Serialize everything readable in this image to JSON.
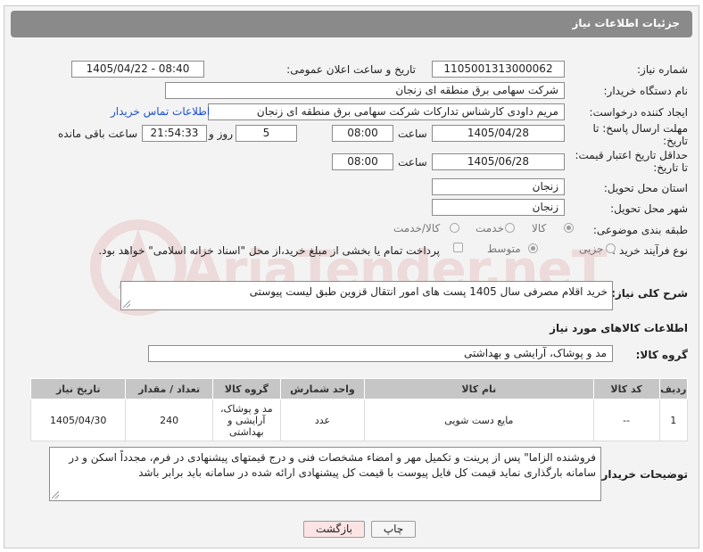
{
  "header": {
    "title": "جزئیات اطلاعات نیاز"
  },
  "watermark": {
    "text": "AriaTender.neT"
  },
  "need_number": {
    "label": "شماره نیاز:",
    "value": "1105001313000062"
  },
  "announce": {
    "label": "تاریخ و ساعت اعلان عمومی:",
    "value": "1405/04/22 - 08:40"
  },
  "buyer_org": {
    "label": "نام دستگاه خریدار:",
    "value": "شرکت سهامی برق منطقه ای زنجان"
  },
  "requester": {
    "label": "ایجاد کننده درخواست:",
    "value": "مریم داودی کارشناس تدارکات شرکت سهامی برق منطقه ای زنجان",
    "contact_link": "اطلاعات تماس خریدار"
  },
  "deadline": {
    "label_line1": "مهلت ارسال پاسخ: تا",
    "label_line2": "تاریخ:",
    "date": "1405/04/28",
    "time_label": "ساعت",
    "time": "08:00",
    "days": "5",
    "days_label": "روز و",
    "remaining": "21:54:33",
    "remaining_label": "ساعت باقی مانده"
  },
  "validity": {
    "label_line1": "حداقل تاریخ اعتبار قیمت:",
    "label_line2": "تا تاریخ:",
    "date": "1405/06/28",
    "time_label": "ساعت",
    "time": "08:00"
  },
  "province": {
    "label": "استان محل تحویل:",
    "value": "زنجان"
  },
  "city": {
    "label": "شهر محل تحویل:",
    "value": "زنجان"
  },
  "category": {
    "label": "طبقه بندی موضوعی:",
    "options": [
      "کالا",
      "خدمت",
      "کالا/خدمت"
    ]
  },
  "process": {
    "label": "نوع فرآیند خرید :",
    "options": [
      "جزیی",
      "متوسط"
    ],
    "payment_note": "پرداخت تمام یا بخشی از مبلغ خرید،از محل \"اسناد خزانه اسلامی\" خواهد بود."
  },
  "summary": {
    "label": "شرح کلی نیاز:",
    "value": "خرید اقلام مصرفی سال 1405  پست های امور انتقال قزوین طبق لیست پیوستی"
  },
  "goods_section": {
    "title": "اطلاعات کالاهای مورد نیاز"
  },
  "goods_group": {
    "label": "گروه کالا:",
    "value": "مد و پوشاک، آرایشی و بهداشتی"
  },
  "table": {
    "headers": [
      "ردیف",
      "کد کالا",
      "نام کالا",
      "واحد شمارش",
      "گروه کالا",
      "تعداد / مقدار",
      "تاریخ نیاز"
    ],
    "rows": [
      [
        "1",
        "--",
        "مایع دست شویی",
        "عدد",
        "مد و پوشاک، آرایشی و بهداشتی",
        "240",
        "1405/04/30"
      ]
    ]
  },
  "buyer_notes": {
    "label": "توضیحات خریدار:",
    "value": "فروشنده الزاما\" پس از پرینت و تکمیل مهر و امضاء مشخصات فنی و درج قیمتهای پیشنهادی در فرم، مجدداً اسکن و در سامانه بارگذاری نماید قیمت کل فایل پیوست با قیمت کل پیشنهادی ارائه شده در سامانه باید برابر باشد"
  },
  "buttons": {
    "print": "چاپ",
    "back": "بازگشت"
  }
}
